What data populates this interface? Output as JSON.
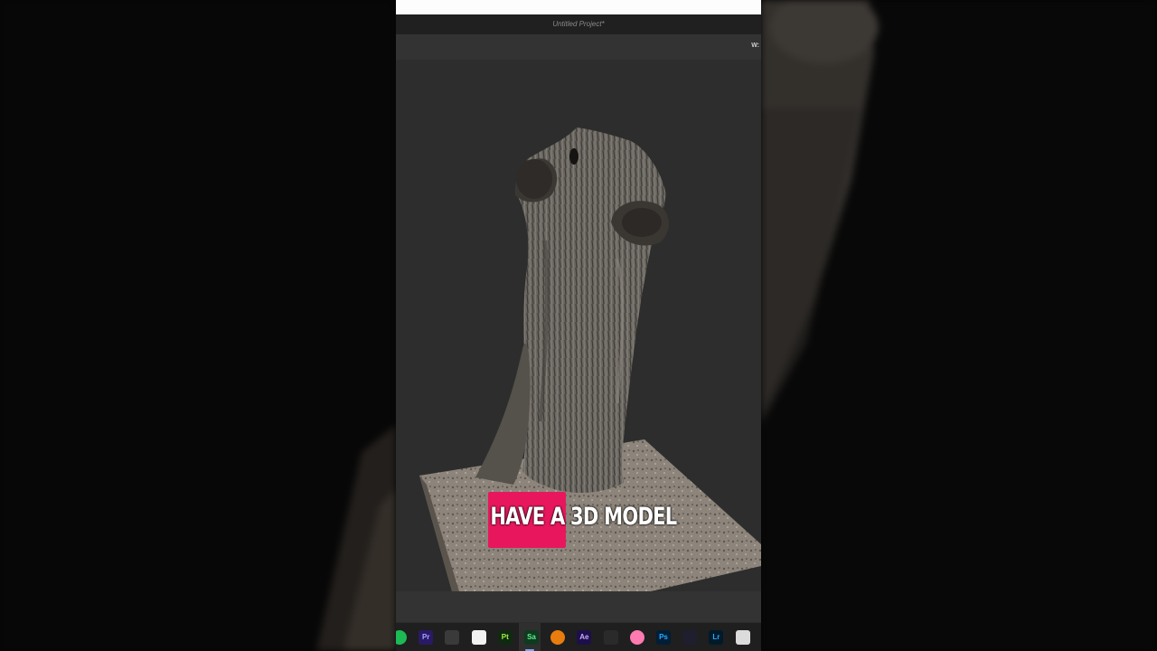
{
  "window": {
    "title": "Untitled Project*"
  },
  "toolbar": {
    "label": "W:"
  },
  "caption": {
    "highlight": "HAVE A",
    "rest": " 3D MODEL"
  },
  "taskbar": {
    "icons": [
      {
        "name": "spotify-icon",
        "label": "",
        "color": "#1db954"
      },
      {
        "name": "premiere-pro-icon",
        "label": "Pr",
        "color": "#2a1a66",
        "text": "#a4a4ff"
      },
      {
        "name": "davinci-resolve-icon",
        "label": "",
        "color": "#3a3a3a"
      },
      {
        "name": "capcut-icon",
        "label": "",
        "color": "#f2f2f2"
      },
      {
        "name": "substance-painter-icon",
        "label": "Pt",
        "color": "#0f2a10",
        "text": "#a6f04a"
      },
      {
        "name": "substance-sampler-icon",
        "label": "Sa",
        "color": "#103a20",
        "text": "#5ef08a"
      },
      {
        "name": "blender-icon",
        "label": "",
        "color": "#e87d0d"
      },
      {
        "name": "after-effects-icon",
        "label": "Ae",
        "color": "#1d0f4a",
        "text": "#c9a8ff"
      },
      {
        "name": "zbrush-icon",
        "label": "",
        "color": "#2a2a2a"
      },
      {
        "name": "photos-icon",
        "label": "",
        "color": "#ff7ab0"
      },
      {
        "name": "photoshop-icon",
        "label": "Ps",
        "color": "#001e36",
        "text": "#31a8ff"
      },
      {
        "name": "davinci-color-icon",
        "label": "",
        "color": "#1e1e2e"
      },
      {
        "name": "lightroom-icon",
        "label": "Lr",
        "color": "#001a2a",
        "text": "#31a8ff"
      },
      {
        "name": "obs-icon",
        "label": "",
        "color": "#dcdcdc"
      }
    ]
  }
}
